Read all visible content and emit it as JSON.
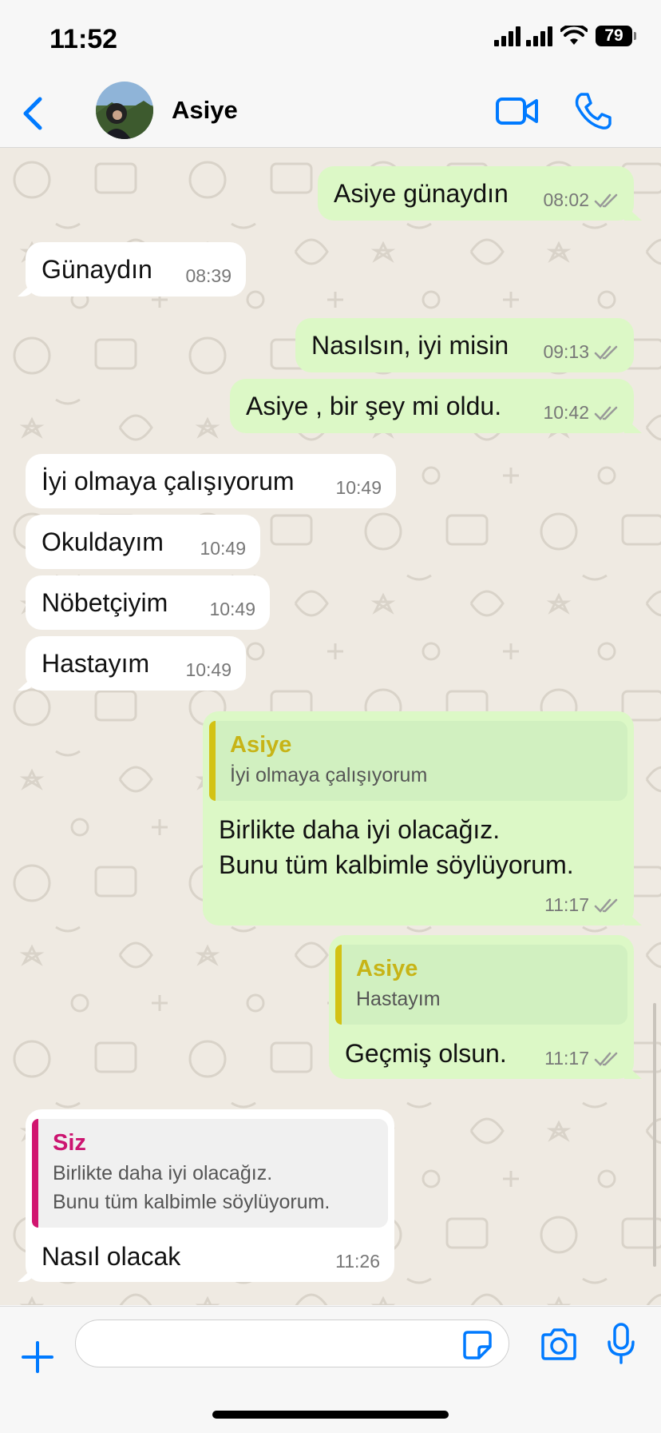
{
  "status_bar": {
    "time": "11:52",
    "battery": "79"
  },
  "header": {
    "contact_name": "Asiye"
  },
  "colors": {
    "accent": "#007aff",
    "outgoing_bubble": "#dcf8c6",
    "incoming_bubble": "#ffffff",
    "reply_asiye": "#c7b417",
    "reply_siz": "#cc1470"
  },
  "messages": [
    {
      "text": "Asiye günaydın",
      "time": "08:02"
    },
    {
      "text": "Günaydın",
      "time": "08:39"
    },
    {
      "text": "Nasılsın, iyi misin",
      "time": "09:13"
    },
    {
      "text": "Asiye , bir şey mi oldu.",
      "time": "10:42"
    },
    {
      "text": "İyi olmaya çalışıyorum",
      "time": "10:49"
    },
    {
      "text": "Okuldayım",
      "time": "10:49"
    },
    {
      "text": "Nöbetçiyim",
      "time": "10:49"
    },
    {
      "text": "Hastayım",
      "time": "10:49"
    },
    {
      "quote_author": "Asiye",
      "quote_text": "İyi olmaya çalışıyorum",
      "text": "Birlikte daha iyi olacağız.\nBunu tüm kalbimle söylüyorum.",
      "time": "11:17"
    },
    {
      "quote_author": "Asiye",
      "quote_text": "Hastayım",
      "text": "Geçmiş olsun.",
      "time": "11:17"
    },
    {
      "quote_author": "Siz",
      "quote_text": "Birlikte daha iyi olacağız.\nBunu tüm kalbimle söylüyorum.",
      "text": "Nasıl olacak",
      "time": "11:26"
    }
  ],
  "input": {
    "value": "",
    "placeholder": ""
  },
  "icons": {
    "back": "chevron-left-icon",
    "video": "video-camera-icon",
    "call": "phone-icon",
    "plus": "plus-icon",
    "sticker": "sticker-icon",
    "camera": "camera-icon",
    "mic": "microphone-icon",
    "read_receipt": "double-check-icon"
  }
}
